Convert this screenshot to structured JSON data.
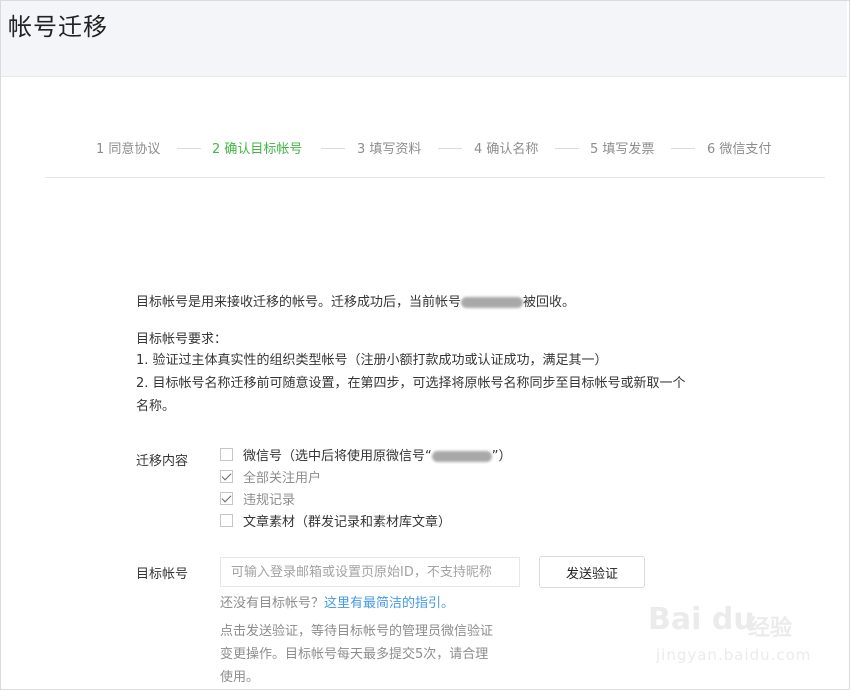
{
  "header": {
    "title": "帐号迁移"
  },
  "steps": [
    {
      "label": "1 同意协议",
      "active": false
    },
    {
      "label": "2 确认目标帐号",
      "active": true
    },
    {
      "label": "3 填写资料",
      "active": false
    },
    {
      "label": "4 确认名称",
      "active": false
    },
    {
      "label": "5 填写发票",
      "active": false
    },
    {
      "label": "6 微信支付",
      "active": false
    }
  ],
  "intro": {
    "line_prefix": "目标帐号是用来接收迁移的帐号。迁移成功后，当前帐号",
    "line_suffix": "被回收。"
  },
  "requirements": {
    "title": "目标帐号要求：",
    "items": [
      "1. 验证过主体真实性的组织类型帐号（注册小额打款成功或认证成功，满足其一）",
      "2. 目标帐号名称迁移前可随意设置，在第四步，可选择将原帐号名称同步至目标帐号或新取一个",
      "名称。"
    ]
  },
  "migrate_content": {
    "label": "迁移内容",
    "options": [
      {
        "label_prefix": "微信号（选中后将使用原微信号“",
        "label_suffix": "”）",
        "checked": false,
        "disabled": false
      },
      {
        "label_prefix": "全部关注用户",
        "label_suffix": "",
        "checked": true,
        "disabled": true
      },
      {
        "label_prefix": "违规记录",
        "label_suffix": "",
        "checked": true,
        "disabled": true
      },
      {
        "label_prefix": "文章素材（群发记录和素材库文章）",
        "label_suffix": "",
        "checked": false,
        "disabled": false
      }
    ]
  },
  "target_account": {
    "label": "目标帐号",
    "placeholder": "可输入登录邮箱或设置页原始ID，不支持昵称",
    "value": "",
    "send_button": "发送验证",
    "hint_prefix": "还没有目标帐号？",
    "hint_link": "这里有最简洁的指引。",
    "note_lines": [
      "点击发送验证，等待目标帐号的管理员微信验证",
      "变更操作。目标帐号每天最多提交5次，请合理",
      "使用。"
    ]
  },
  "watermark": {
    "logo": "Bai du",
    "cn": "经验",
    "url": "jingyan.baidu.com"
  },
  "colors": {
    "accent": "#44b549",
    "link": "#459ae9",
    "muted": "#8d8d8d"
  }
}
